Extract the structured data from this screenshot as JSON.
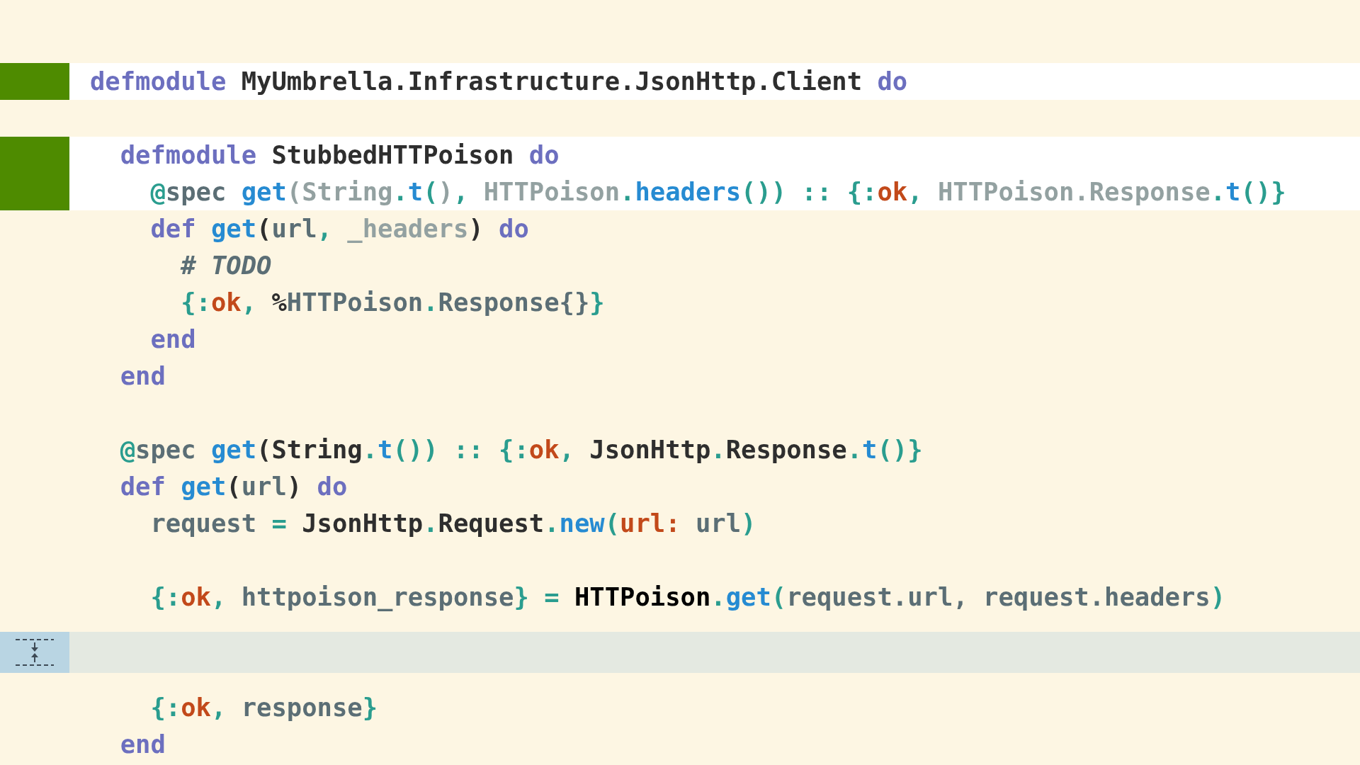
{
  "blocks": [
    {
      "kind": "added",
      "lines": [
        {
          "kind": "code",
          "tokens": [
            {
              "text": "defmodule",
              "kind": "keyword"
            },
            {
              "text": " MyUmbrella.Infrastructure.JsonHttp.Client ",
              "kind": "module"
            },
            {
              "text": "do",
              "kind": "keyword"
            }
          ]
        }
      ]
    },
    {
      "kind": "context",
      "lines": [
        {
          "kind": "blank"
        }
      ]
    },
    {
      "kind": "added",
      "lines": [
        {
          "kind": "code",
          "tokens": [
            {
              "text": "  defmodule",
              "kind": "keyword"
            },
            {
              "text": " StubbedHTTPoison ",
              "kind": "module"
            },
            {
              "text": "do",
              "kind": "keyword"
            }
          ]
        },
        {
          "kind": "code",
          "tokens": [
            {
              "text": "    @",
              "kind": "punctuation"
            },
            {
              "text": "spec ",
              "kind": "variable"
            },
            {
              "text": "get",
              "kind": "function"
            },
            {
              "text": "(",
              "kind": "dimmed"
            },
            {
              "text": "String",
              "kind": "dimmed"
            },
            {
              "text": ".",
              "kind": "punctuation"
            },
            {
              "text": "t",
              "kind": "function"
            },
            {
              "text": "(",
              "kind": "punctuation"
            },
            {
              "text": ")",
              "kind": "dimmed"
            },
            {
              "text": ", ",
              "kind": "punctuation"
            },
            {
              "text": "HTTPoison",
              "kind": "dimmed"
            },
            {
              "text": ".",
              "kind": "punctuation"
            },
            {
              "text": "headers",
              "kind": "function"
            },
            {
              "text": "()) :: {:",
              "kind": "punctuation"
            },
            {
              "text": "ok",
              "kind": "atom"
            },
            {
              "text": ", ",
              "kind": "punctuation"
            },
            {
              "text": "HTTPoison.Response",
              "kind": "dimmed"
            },
            {
              "text": ".",
              "kind": "punctuation"
            },
            {
              "text": "t",
              "kind": "function"
            },
            {
              "text": "()}",
              "kind": "punctuation"
            }
          ]
        }
      ]
    },
    {
      "kind": "context",
      "lines": [
        {
          "kind": "code",
          "tokens": [
            {
              "text": "    def",
              "kind": "keyword"
            },
            {
              "text": " get",
              "kind": "function"
            },
            {
              "text": "(",
              "kind": "plain"
            },
            {
              "text": "url",
              "kind": "variable"
            },
            {
              "text": ", ",
              "kind": "punctuation"
            },
            {
              "text": "_headers",
              "kind": "dimmed"
            },
            {
              "text": ")",
              "kind": "plain"
            },
            {
              "text": " do",
              "kind": "keyword"
            }
          ]
        },
        {
          "kind": "code",
          "tokens": [
            {
              "text": "      # TODO",
              "kind": "comment"
            }
          ]
        },
        {
          "kind": "code",
          "tokens": [
            {
              "text": "      {:",
              "kind": "punctuation"
            },
            {
              "text": "ok",
              "kind": "atom"
            },
            {
              "text": ", ",
              "kind": "punctuation"
            },
            {
              "text": "%",
              "kind": "plain"
            },
            {
              "text": "HTTPoison",
              "kind": "variable"
            },
            {
              "text": ".",
              "kind": "punctuation"
            },
            {
              "text": "Response{}",
              "kind": "variable"
            },
            {
              "text": "}",
              "kind": "punctuation"
            }
          ]
        },
        {
          "kind": "code",
          "tokens": [
            {
              "text": "    end",
              "kind": "keyword"
            }
          ]
        },
        {
          "kind": "code",
          "tokens": [
            {
              "text": "  end",
              "kind": "keyword"
            }
          ]
        },
        {
          "kind": "blank"
        },
        {
          "kind": "code",
          "tokens": [
            {
              "text": "  @",
              "kind": "punctuation"
            },
            {
              "text": "spec ",
              "kind": "variable"
            },
            {
              "text": "get",
              "kind": "function"
            },
            {
              "text": "(",
              "kind": "plain"
            },
            {
              "text": "String",
              "kind": "plain"
            },
            {
              "text": ".",
              "kind": "punctuation"
            },
            {
              "text": "t",
              "kind": "function"
            },
            {
              "text": "())",
              "kind": "punctuation"
            },
            {
              "text": " :: {:",
              "kind": "punctuation"
            },
            {
              "text": "ok",
              "kind": "atom"
            },
            {
              "text": ", ",
              "kind": "punctuation"
            },
            {
              "text": "JsonHttp",
              "kind": "plain"
            },
            {
              "text": ".",
              "kind": "punctuation"
            },
            {
              "text": "Response",
              "kind": "plain"
            },
            {
              "text": ".",
              "kind": "punctuation"
            },
            {
              "text": "t",
              "kind": "function"
            },
            {
              "text": "()}",
              "kind": "punctuation"
            }
          ]
        },
        {
          "kind": "code",
          "tokens": [
            {
              "text": "  def",
              "kind": "keyword"
            },
            {
              "text": " get",
              "kind": "function"
            },
            {
              "text": "(",
              "kind": "plain"
            },
            {
              "text": "url",
              "kind": "variable"
            },
            {
              "text": ") ",
              "kind": "plain"
            },
            {
              "text": "do",
              "kind": "keyword"
            }
          ]
        },
        {
          "kind": "code",
          "tokens": [
            {
              "text": "    request ",
              "kind": "variable"
            },
            {
              "text": "= ",
              "kind": "punctuation"
            },
            {
              "text": "JsonHttp",
              "kind": "plain"
            },
            {
              "text": ".",
              "kind": "punctuation"
            },
            {
              "text": "Request",
              "kind": "plain"
            },
            {
              "text": ".",
              "kind": "punctuation"
            },
            {
              "text": "new",
              "kind": "function"
            },
            {
              "text": "(",
              "kind": "punctuation"
            },
            {
              "text": "url:",
              "kind": "atom"
            },
            {
              "text": " url",
              "kind": "variable"
            },
            {
              "text": ")",
              "kind": "punctuation"
            }
          ]
        },
        {
          "kind": "blank"
        },
        {
          "kind": "code",
          "tokens": [
            {
              "text": "    {:",
              "kind": "punctuation"
            },
            {
              "text": "ok",
              "kind": "atom"
            },
            {
              "text": ", ",
              "kind": "punctuation"
            },
            {
              "text": "httpoison_response",
              "kind": "variable"
            },
            {
              "text": "} = ",
              "kind": "punctuation"
            },
            {
              "text": "HTTPoison",
              "kind": "strong"
            },
            {
              "text": ".",
              "kind": "punctuation"
            },
            {
              "text": "get",
              "kind": "function"
            },
            {
              "text": "(",
              "kind": "punctuation"
            },
            {
              "text": "request.url, request.headers",
              "kind": "variable"
            },
            {
              "text": ")",
              "kind": "punctuation"
            }
          ]
        }
      ]
    },
    {
      "kind": "collapsed"
    },
    {
      "kind": "context",
      "lines": [
        {
          "kind": "code",
          "tokens": [
            {
              "text": "    {:",
              "kind": "punctuation"
            },
            {
              "text": "ok",
              "kind": "atom"
            },
            {
              "text": ", ",
              "kind": "punctuation"
            },
            {
              "text": "response",
              "kind": "variable"
            },
            {
              "text": "}",
              "kind": "punctuation"
            }
          ]
        },
        {
          "kind": "code",
          "tokens": [
            {
              "text": "  end",
              "kind": "keyword"
            }
          ]
        }
      ]
    }
  ]
}
